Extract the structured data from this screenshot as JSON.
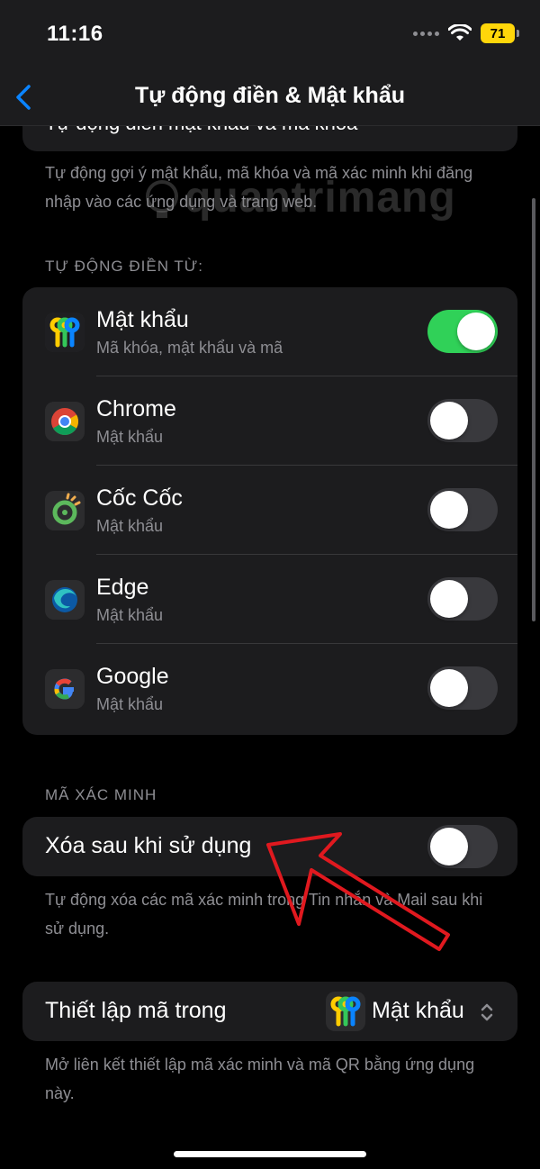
{
  "status": {
    "time": "11:16",
    "battery": "71"
  },
  "nav": {
    "title": "Tự động điền & Mật khẩu",
    "back_icon": "chevron-left-icon"
  },
  "top_partial": {
    "label": "Tự động điền mật khẩu và mã khóa",
    "on": true
  },
  "top_footnote": "Tự động gợi ý mật khẩu, mã khóa và mã xác minh khi đăng nhập vào các ứng dụng và trang web.",
  "watermark": "quantrimang",
  "autofill_from": {
    "header": "TỰ ĐỘNG ĐIỀN TỪ:",
    "items": [
      {
        "title": "Mật khẩu",
        "subtitle": "Mã khóa, mật khẩu và mã",
        "icon": "passwords-app-icon",
        "on": true
      },
      {
        "title": "Chrome",
        "subtitle": "Mật khẩu",
        "icon": "chrome-icon",
        "on": false
      },
      {
        "title": "Cốc Cốc",
        "subtitle": "Mật khẩu",
        "icon": "coccoc-icon",
        "on": false
      },
      {
        "title": "Edge",
        "subtitle": "Mật khẩu",
        "icon": "edge-icon",
        "on": false
      },
      {
        "title": "Google",
        "subtitle": "Mật khẩu",
        "icon": "google-icon",
        "on": false
      }
    ]
  },
  "verification": {
    "header": "MÃ XÁC MINH",
    "delete_after_use": {
      "label": "Xóa sau khi sử dụng",
      "on": false
    },
    "footnote": "Tự động xóa các mã xác minh trong Tin nhắn và Mail sau khi sử dụng."
  },
  "setup_codes": {
    "label": "Thiết lập mã trong",
    "value": "Mật khẩu",
    "footnote": "Mở liên kết thiết lập mã xác minh và mã QR bằng ứng dụng này."
  },
  "colors": {
    "accent_blue": "#0a84ff",
    "toggle_on": "#30d158",
    "annotation_red": "#e0191f"
  }
}
